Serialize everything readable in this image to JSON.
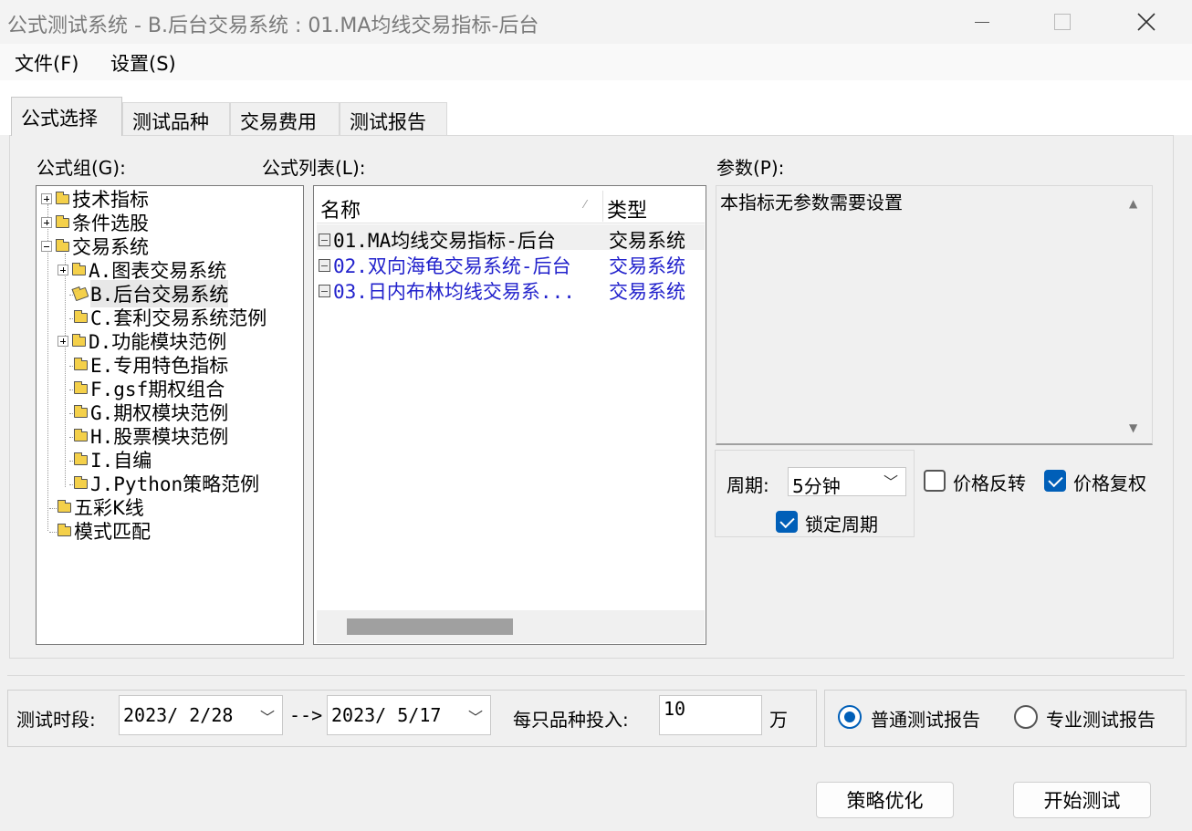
{
  "window": {
    "title": "公式测试系统 - B.后台交易系统 : 01.MA均线交易指标-后台"
  },
  "menu": [
    {
      "label": "文件(F)"
    },
    {
      "label": "设置(S)"
    }
  ],
  "tabs": [
    {
      "label": "公式选择"
    },
    {
      "label": "测试品种"
    },
    {
      "label": "交易费用"
    },
    {
      "label": "测试报告"
    }
  ],
  "labels": {
    "group": "公式组(G):",
    "list": "公式列表(L):",
    "params": "参数(P):"
  },
  "tree": [
    {
      "label": "技术指标"
    },
    {
      "label": "条件选股"
    },
    {
      "label": "交易系统"
    },
    {
      "label": "A.图表交易系统"
    },
    {
      "label": "B.后台交易系统"
    },
    {
      "label": "C.套利交易系统范例"
    },
    {
      "label": "D.功能模块范例"
    },
    {
      "label": "E.专用特色指标"
    },
    {
      "label": "F.gsf期权组合"
    },
    {
      "label": "G.期权模块范例"
    },
    {
      "label": "H.股票模块范例"
    },
    {
      "label": "I.自编"
    },
    {
      "label": "J.Python策略范例"
    },
    {
      "label": "五彩K线"
    },
    {
      "label": "模式匹配"
    }
  ],
  "formula_list": {
    "columns": [
      "名称",
      "类型"
    ],
    "rows": [
      {
        "name": "01.MA均线交易指标-后台",
        "type": "交易系统"
      },
      {
        "name": "02.双向海龟交易系统-后台",
        "type": "交易系统"
      },
      {
        "name": "03.日内布林均线交易系...",
        "type": "交易系统"
      }
    ]
  },
  "params": {
    "text": "本指标无参数需要设置",
    "period_label": "周期:",
    "period_value": "5分钟",
    "lock_period": "锁定周期",
    "price_reverse": "价格反转",
    "price_adjust": "价格复权"
  },
  "range": {
    "label": "测试时段:",
    "start": "2023/ 2/28",
    "arrow": "-->",
    "end": "2023/ 5/17",
    "invest_label": "每只品种投入:",
    "invest_value": "10",
    "unit": "万"
  },
  "report": {
    "normal": "普通测试报告",
    "pro": "专业测试报告"
  },
  "buttons": {
    "optimize": "策略优化",
    "start": "开始测试"
  }
}
